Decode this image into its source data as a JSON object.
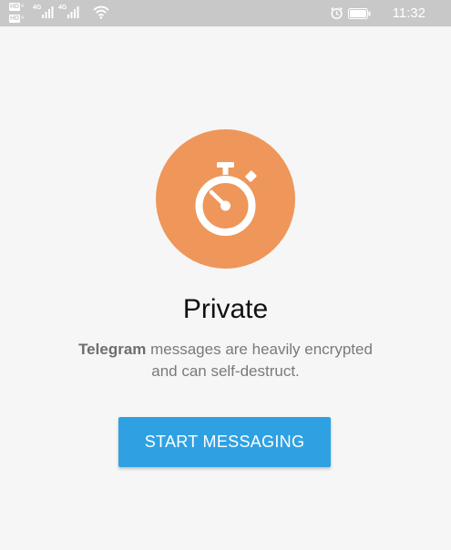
{
  "status_bar": {
    "hd_top": "HD",
    "hd_bottom": "HD",
    "net_1": "4G",
    "net_2": "4G",
    "time": "11:32"
  },
  "onboarding": {
    "title": "Private",
    "subtitle_bold": "Telegram",
    "subtitle_line1_rest": " messages are heavily encrypted",
    "subtitle_line2": "and can self-destruct.",
    "start_button_label": "START MESSAGING"
  },
  "colors": {
    "icon_circle": "#ef965a",
    "button": "#2fa1e2",
    "status_bar": "#c8c8c8",
    "background": "#f6f6f6"
  },
  "icons": {
    "main": "stopwatch-icon"
  }
}
